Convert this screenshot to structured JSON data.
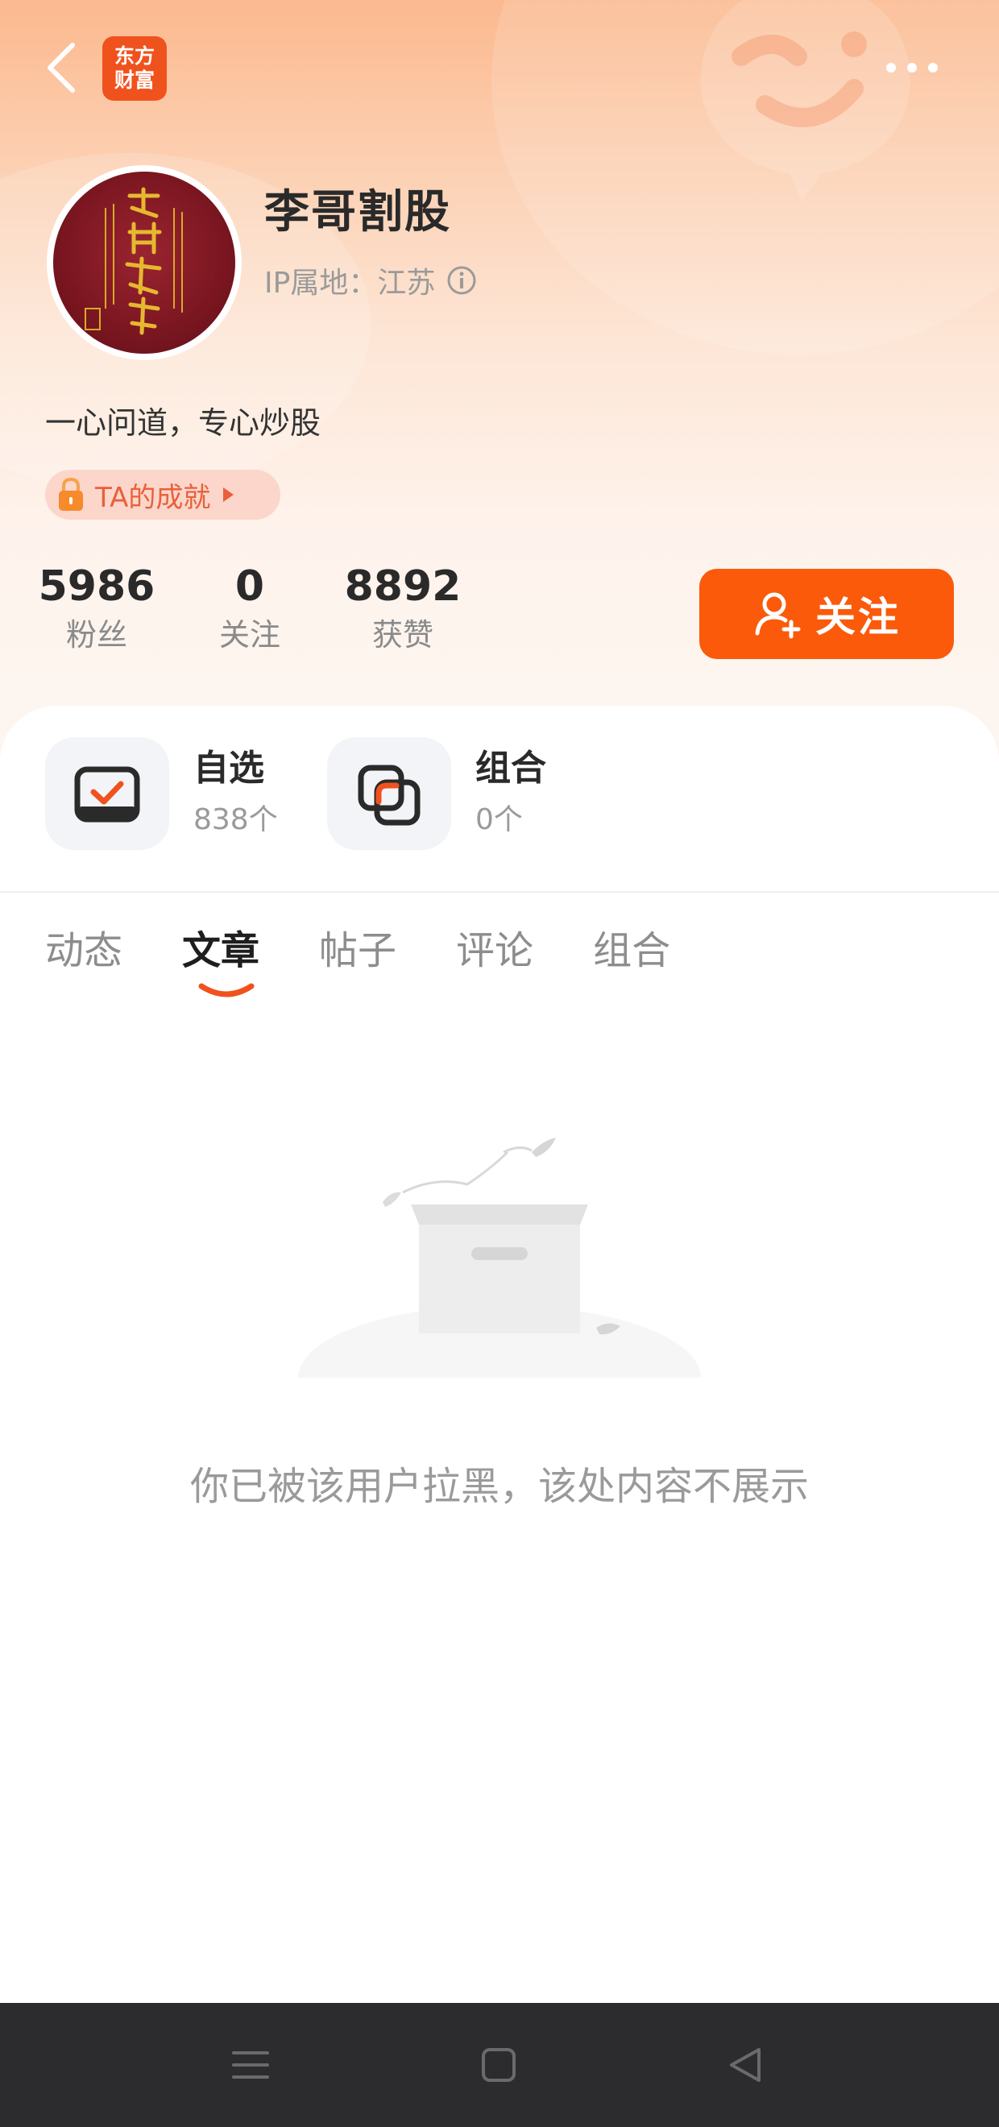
{
  "app": {
    "logo_line1": "东方",
    "logo_line2": "财富"
  },
  "profile": {
    "name": "李哥割股",
    "ip_location": "IP属地：江苏",
    "bio": "一心问道，专心炒股",
    "achievement_label": "TA的成就"
  },
  "stats": [
    {
      "value": "5986",
      "label": "粉丝"
    },
    {
      "value": "0",
      "label": "关注"
    },
    {
      "value": "8892",
      "label": "获赞"
    }
  ],
  "follow_button": {
    "label": "关注"
  },
  "quick_links": [
    {
      "title": "自选",
      "count": "838个",
      "icon": "watchlist-check-icon"
    },
    {
      "title": "组合",
      "count": "0个",
      "icon": "portfolio-overlap-icon"
    }
  ],
  "tabs": [
    {
      "label": "动态",
      "active": false
    },
    {
      "label": "文章",
      "active": true
    },
    {
      "label": "帖子",
      "active": false
    },
    {
      "label": "评论",
      "active": false
    },
    {
      "label": "组合",
      "active": false
    }
  ],
  "empty_state": {
    "message": "你已被该用户拉黑，该处内容不展示"
  },
  "colors": {
    "accent": "#fa5a0a",
    "badge_bg": "#fcd6cb",
    "navbar": "#2c2c2e"
  },
  "system_nav": [
    "menu-icon",
    "home-square-icon",
    "back-triangle-icon"
  ]
}
